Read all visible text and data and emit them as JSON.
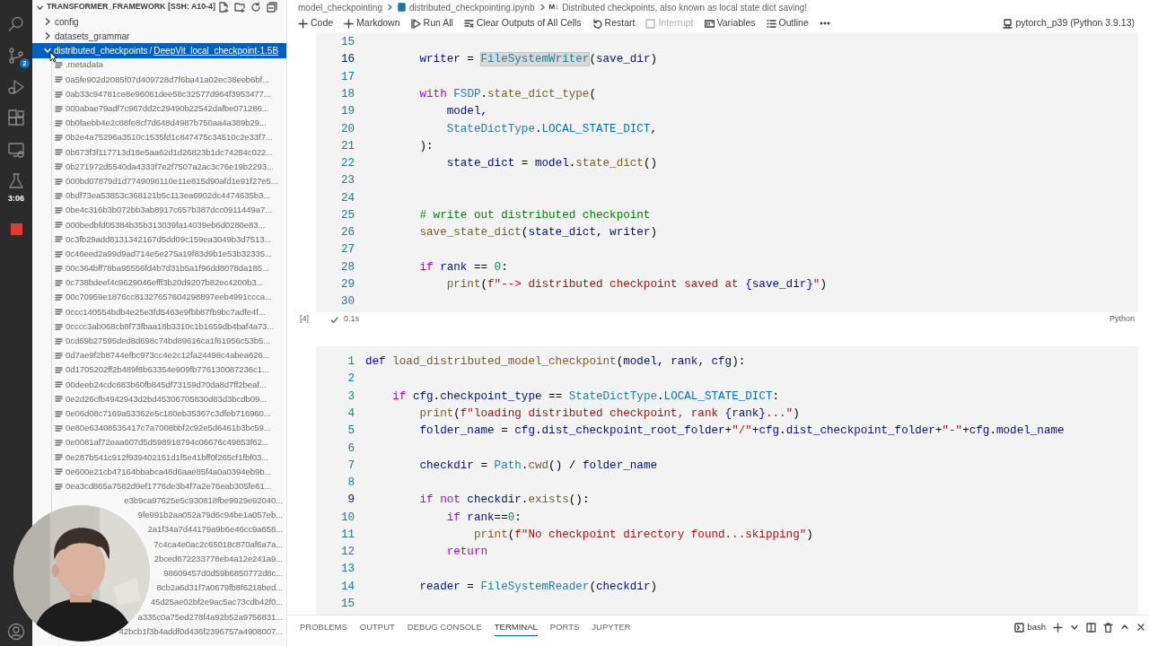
{
  "activity_bar": {
    "items": [
      {
        "kind": "search"
      },
      {
        "kind": "source-control",
        "badge": "2"
      },
      {
        "kind": "run-debug"
      },
      {
        "kind": "extensions"
      },
      {
        "kind": "remote"
      },
      {
        "kind": "testing"
      }
    ],
    "timer": "3:06",
    "recording": true
  },
  "explorer": {
    "title": "TRANSFORMER_FRAMEWORK [SSH: A10-4]",
    "tree": [
      {
        "label": "config",
        "expanded": false,
        "selected": false
      },
      {
        "label": "datasets_grammar",
        "expanded": false,
        "selected": false
      },
      {
        "label": "distributed_checkpoints",
        "separator": "/",
        "sublabel": "DeepVit_local_checkpoint-1.5B",
        "expanded": true,
        "selected": true,
        "children": [
          {
            "label": ".metadata",
            "kind": "file",
            "selected": false
          },
          {
            "label": "0a5fe902d2085f07d409728d7f6ba41a02ec38eeb6bf...",
            "kind": "file",
            "selected": false
          },
          {
            "label": "0ab33c94781ce8e96061dee58c32577d964f3953477...",
            "kind": "file",
            "selected": false
          },
          {
            "label": "000abae79adf7c967dd2c29490b22542dafbe071286...",
            "kind": "file",
            "selected": false
          },
          {
            "label": "0b0faebb4e2c88fe8cf7d648d4987b750aa4a389b29...",
            "kind": "file",
            "selected": false
          },
          {
            "label": "0b2e4a75296a3510c1535fd1c847475c34510c2e33f7...",
            "kind": "file",
            "selected": false
          },
          {
            "label": "0b673f3f117713d18e5aa62d1d26823b1dc74284c022...",
            "kind": "file",
            "selected": false
          },
          {
            "label": "0b271972d5540da4333f7e2f7507a2ac3c76e19b2293...",
            "kind": "file",
            "selected": false
          },
          {
            "label": "000bd07879d1d7749096110e11e815d90afd1e91f27e5...",
            "kind": "file",
            "selected": false
          },
          {
            "label": "0bdf73ea53853c368121b5c113ea6902dc4474635b3...",
            "kind": "file",
            "selected": false
          },
          {
            "label": "0be4c316b3b072bb3ab8917c657b387dcc0911449a7...",
            "kind": "file",
            "selected": false
          },
          {
            "label": "000bedbfd05384b35b313039fa14039eb6d0280e83...",
            "kind": "file",
            "selected": false
          },
          {
            "label": "0c3fb29add8131342167d5dd09c159ea3049b3d7513...",
            "kind": "file",
            "selected": false
          },
          {
            "label": "0c46eed2a99d9ad714e5e275a19f83d9b1e53b32335...",
            "kind": "file",
            "selected": false
          },
          {
            "label": "00c364bff78ba95556fd4b7d31b5a1f96dd8078da185...",
            "kind": "file",
            "selected": false
          },
          {
            "label": "0c738bdeef4c9629046efff3b20d9207b82ec4200b3...",
            "kind": "file",
            "selected": false
          },
          {
            "label": "00c70959e1876cc81327657604298897eeb4991ccca...",
            "kind": "file",
            "selected": false
          },
          {
            "label": "0ccc140554bdb4e25e3fd5463e9fbb87fb9bc7adfe4f...",
            "kind": "file",
            "selected": false
          },
          {
            "label": "0cccc3ab068cb8f73fbaa18b3310c1b1659db4baf4a73...",
            "kind": "file",
            "selected": false
          },
          {
            "label": "0cd69b27595ded8d698c74bd89616ca1f61956c53b5...",
            "kind": "file",
            "selected": false
          },
          {
            "label": "0d7ae9f2b8744efbc973cc4e2c12fa24498c4abea626...",
            "kind": "file",
            "selected": false
          },
          {
            "label": "0d1705202ff2b489f8b63354e909fb776130087236c1...",
            "kind": "file",
            "selected": false
          },
          {
            "label": "00deeb24cdc683b60fb845df73159d70da8d7ff2beaf...",
            "kind": "file",
            "selected": false
          },
          {
            "label": "0e2d26cfb4942943d2bd45306705830d83d3bcdb09...",
            "kind": "file",
            "selected": false
          },
          {
            "label": "0e06d08c7169a53362e5c180eb35367c3dfeb716960...",
            "kind": "file",
            "selected": false
          },
          {
            "label": "0e80e63408535417c7a7008bbf2c92e5d6461b3bc59...",
            "kind": "file",
            "selected": false
          },
          {
            "label": "0e0081af72eaa607d5d598918794c06676c49853f62...",
            "kind": "file",
            "selected": false
          },
          {
            "label": "0e287b541c912f939402151d1f5e41bff0f265cf1fbf03...",
            "kind": "file",
            "selected": false
          },
          {
            "label": "0e600e21cb47164bbabca48d6aae85f4a0a0394eb9b...",
            "kind": "file",
            "selected": false
          },
          {
            "label": "0ea3cd865a7582d9ef1776de3b4f7a2e76eab305fe61...",
            "kind": "file",
            "selected": false
          },
          {
            "label": "e3b9ca97625e5c930818fbe9929e92040...",
            "kind": "covered",
            "selected": false
          },
          {
            "label": "9fe991b2aa052a79d6c94be1a057eb...",
            "kind": "covered",
            "selected": false
          },
          {
            "label": "2a1f34a7d44179a9b6e46cc9a658...",
            "kind": "covered",
            "selected": false
          },
          {
            "label": "7c4ca4e0ac2c65018c870af6a7a...",
            "kind": "covered",
            "selected": false
          },
          {
            "label": "2bced672233778eb4a12e241a9...",
            "kind": "covered",
            "selected": false
          },
          {
            "label": "98609457d0d59b6850772d8c...",
            "kind": "covered",
            "selected": false
          },
          {
            "label": "8cb2a6d31f7a0679fb8f6218bed...",
            "kind": "covered",
            "selected": false
          },
          {
            "label": "45d25ae02bf2e9ac5ac73cdb42f0...",
            "kind": "covered",
            "selected": false
          },
          {
            "label": "a335c0a75ed278f4a92b52a9756831...",
            "kind": "covered",
            "selected": false
          },
          {
            "label": "42bcb1f3b4addf0d436f2396757a4908007...",
            "kind": "covered",
            "selected": false
          }
        ]
      }
    ]
  },
  "breadcrumbs": [
    {
      "label": "model_checkpointing",
      "kind": "folder"
    },
    {
      "label": "distributed_checkpointing.ipynb",
      "kind": "notebook"
    },
    {
      "label": "Distributed checkpoints, also known as local state dict saving!",
      "kind": "markdown",
      "icon": "M↓"
    }
  ],
  "toolbar": [
    {
      "label": "Code",
      "kind": "add",
      "disabled": false
    },
    {
      "label": "Markdown",
      "kind": "add",
      "disabled": false
    },
    {
      "label": "Run All",
      "kind": "run",
      "disabled": false
    },
    {
      "label": "Clear Outputs of All Cells",
      "kind": "clear",
      "disabled": false
    },
    {
      "label": "Restart",
      "kind": "restart",
      "disabled": false
    },
    {
      "label": "Interrupt",
      "kind": "interrupt",
      "disabled": true
    },
    {
      "label": "Variables",
      "kind": "variables",
      "disabled": false
    },
    {
      "label": "Outline",
      "kind": "outline",
      "disabled": false
    },
    {
      "kind": "more",
      "disabled": false
    }
  ],
  "kernel": "pytorch_p39 (Python 3.9.13)",
  "cells": [
    {
      "execution_count": "[4]",
      "succeeded": true,
      "duration": "0.1s",
      "language": "Python",
      "lines": [
        {
          "number": "15",
          "active": false
        },
        {
          "number": "16",
          "active": true,
          "tokens": [
            {
              "text": "        writer",
              "kind": "var"
            },
            {
              "text": " = ",
              "kind": "plain"
            },
            {
              "text": "FileSystemWriter",
              "kind": "match"
            },
            {
              "text": "(",
              "kind": "plain"
            },
            {
              "text": "save_dir",
              "kind": "var"
            },
            {
              "text": ")",
              "kind": "plain"
            }
          ]
        },
        {
          "number": "17",
          "active": false
        },
        {
          "number": "18",
          "active": false,
          "tokens": [
            {
              "text": "        with",
              "kind": "kw"
            },
            {
              "text": " FSDP",
              "kind": "cls"
            },
            {
              "text": ".",
              "kind": "plain"
            },
            {
              "text": "state_dict_type",
              "kind": "fn"
            },
            {
              "text": "(",
              "kind": "plain"
            }
          ]
        },
        {
          "number": "19",
          "active": false,
          "tokens": [
            {
              "text": "            model",
              "kind": "var"
            },
            {
              "text": ",",
              "kind": "plain"
            }
          ]
        },
        {
          "number": "20",
          "active": false,
          "tokens": [
            {
              "text": "            StateDictType",
              "kind": "cls"
            },
            {
              "text": ".",
              "kind": "plain"
            },
            {
              "text": "LOCAL_STATE_DICT",
              "kind": "const"
            },
            {
              "text": ",",
              "kind": "plain"
            }
          ]
        },
        {
          "number": "21",
          "active": false,
          "tokens": [
            {
              "text": "        ):",
              "kind": "plain"
            }
          ]
        },
        {
          "number": "22",
          "active": false,
          "tokens": [
            {
              "text": "            state_dict",
              "kind": "var"
            },
            {
              "text": " = ",
              "kind": "plain"
            },
            {
              "text": "model",
              "kind": "var"
            },
            {
              "text": ".",
              "kind": "plain"
            },
            {
              "text": "state_dict",
              "kind": "fn"
            },
            {
              "text": "()",
              "kind": "plain"
            }
          ]
        },
        {
          "number": "23",
          "active": false
        },
        {
          "number": "24",
          "active": false
        },
        {
          "number": "25",
          "active": false,
          "tokens": [
            {
              "text": "        # write out distributed checkpoint",
              "kind": "com"
            }
          ]
        },
        {
          "number": "26",
          "active": false,
          "tokens": [
            {
              "text": "        save_state_dict",
              "kind": "fn"
            },
            {
              "text": "(",
              "kind": "plain"
            },
            {
              "text": "state_dict",
              "kind": "var"
            },
            {
              "text": ", ",
              "kind": "plain"
            },
            {
              "text": "writer",
              "kind": "var"
            },
            {
              "text": ")",
              "kind": "plain"
            }
          ]
        },
        {
          "number": "27",
          "active": false
        },
        {
          "number": "28",
          "active": false,
          "tokens": [
            {
              "text": "        if",
              "kind": "kw"
            },
            {
              "text": " rank",
              "kind": "var"
            },
            {
              "text": " == ",
              "kind": "plain"
            },
            {
              "text": "0",
              "kind": "num"
            },
            {
              "text": ":",
              "kind": "plain"
            }
          ]
        },
        {
          "number": "29",
          "active": false,
          "tokens": [
            {
              "text": "            print",
              "kind": "fn"
            },
            {
              "text": "(",
              "kind": "plain"
            },
            {
              "text": "f\"--> distributed checkpoint saved at ",
              "kind": "str"
            },
            {
              "text": "{",
              "kind": "brace"
            },
            {
              "text": "save_dir",
              "kind": "var"
            },
            {
              "text": "}",
              "kind": "brace"
            },
            {
              "text": "\"",
              "kind": "str"
            },
            {
              "text": ")",
              "kind": "plain"
            }
          ]
        },
        {
          "number": "30",
          "active": false
        }
      ]
    },
    {
      "lines": [
        {
          "number": "1",
          "active": false,
          "tokens": [
            {
              "text": "def",
              "kind": "storage"
            },
            {
              "text": " load_distributed_model_checkpoint",
              "kind": "fn"
            },
            {
              "text": "(",
              "kind": "plain"
            },
            {
              "text": "model",
              "kind": "var"
            },
            {
              "text": ", ",
              "kind": "plain"
            },
            {
              "text": "rank",
              "kind": "var"
            },
            {
              "text": ", ",
              "kind": "plain"
            },
            {
              "text": "cfg",
              "kind": "var"
            },
            {
              "text": "):",
              "kind": "plain"
            }
          ]
        },
        {
          "number": "2",
          "active": false
        },
        {
          "number": "3",
          "active": false,
          "tokens": [
            {
              "text": "    if",
              "kind": "kw"
            },
            {
              "text": " cfg",
              "kind": "var"
            },
            {
              "text": ".",
              "kind": "plain"
            },
            {
              "text": "checkpoint_type",
              "kind": "var"
            },
            {
              "text": " == ",
              "kind": "plain"
            },
            {
              "text": "StateDictType",
              "kind": "cls"
            },
            {
              "text": ".",
              "kind": "plain"
            },
            {
              "text": "LOCAL_STATE_DICT",
              "kind": "const"
            },
            {
              "text": ":",
              "kind": "plain"
            }
          ]
        },
        {
          "number": "4",
          "active": false,
          "tokens": [
            {
              "text": "        print",
              "kind": "fn"
            },
            {
              "text": "(",
              "kind": "plain"
            },
            {
              "text": "f\"loading distributed checkpoint, rank ",
              "kind": "str"
            },
            {
              "text": "{",
              "kind": "brace"
            },
            {
              "text": "rank",
              "kind": "var"
            },
            {
              "text": "}",
              "kind": "brace"
            },
            {
              "text": "...\"",
              "kind": "str"
            },
            {
              "text": ")",
              "kind": "plain"
            }
          ]
        },
        {
          "number": "5",
          "active": false,
          "tokens": [
            {
              "text": "        folder_name",
              "kind": "var"
            },
            {
              "text": " = ",
              "kind": "plain"
            },
            {
              "text": "cfg",
              "kind": "var"
            },
            {
              "text": ".",
              "kind": "plain"
            },
            {
              "text": "dist_checkpoint_root_folder",
              "kind": "var"
            },
            {
              "text": "+",
              "kind": "plain"
            },
            {
              "text": "\"/\"",
              "kind": "str"
            },
            {
              "text": "+",
              "kind": "plain"
            },
            {
              "text": "cfg",
              "kind": "var"
            },
            {
              "text": ".",
              "kind": "plain"
            },
            {
              "text": "dist_checkpoint_folder",
              "kind": "var"
            },
            {
              "text": "+",
              "kind": "plain"
            },
            {
              "text": "\"-\"",
              "kind": "str"
            },
            {
              "text": "+",
              "kind": "plain"
            },
            {
              "text": "cfg",
              "kind": "var"
            },
            {
              "text": ".",
              "kind": "plain"
            },
            {
              "text": "model_name",
              "kind": "var"
            }
          ]
        },
        {
          "number": "6",
          "active": false
        },
        {
          "number": "7",
          "active": false,
          "tokens": [
            {
              "text": "        checkdir",
              "kind": "var"
            },
            {
              "text": " = ",
              "kind": "plain"
            },
            {
              "text": "Path",
              "kind": "cls"
            },
            {
              "text": ".",
              "kind": "plain"
            },
            {
              "text": "cwd",
              "kind": "fn"
            },
            {
              "text": "() / ",
              "kind": "plain"
            },
            {
              "text": "folder_name",
              "kind": "var"
            }
          ]
        },
        {
          "number": "8",
          "active": false
        },
        {
          "number": "9",
          "active": true,
          "tokens": [
            {
              "text": "        if not",
              "kind": "kw"
            },
            {
              "text": " checkdir",
              "kind": "var"
            },
            {
              "text": ".",
              "kind": "plain"
            },
            {
              "text": "exists",
              "kind": "fn"
            },
            {
              "text": "():",
              "kind": "plain"
            }
          ]
        },
        {
          "number": "10",
          "active": false,
          "tokens": [
            {
              "text": "            if",
              "kind": "kw"
            },
            {
              "text": " rank",
              "kind": "var"
            },
            {
              "text": "==",
              "kind": "plain"
            },
            {
              "text": "0",
              "kind": "num"
            },
            {
              "text": ":",
              "kind": "plain"
            }
          ]
        },
        {
          "number": "11",
          "active": false,
          "tokens": [
            {
              "text": "                print",
              "kind": "fn"
            },
            {
              "text": "(",
              "kind": "plain"
            },
            {
              "text": "f\"No checkpoint directory found...skipping\"",
              "kind": "str"
            },
            {
              "text": ")",
              "kind": "plain"
            }
          ]
        },
        {
          "number": "12",
          "active": false,
          "tokens": [
            {
              "text": "            return",
              "kind": "kw"
            }
          ]
        },
        {
          "number": "13",
          "active": false
        },
        {
          "number": "14",
          "active": false,
          "tokens": [
            {
              "text": "        reader",
              "kind": "var"
            },
            {
              "text": " = ",
              "kind": "plain"
            },
            {
              "text": "FileSystemReader",
              "kind": "cls"
            },
            {
              "text": "(",
              "kind": "plain"
            },
            {
              "text": "checkdir",
              "kind": "var"
            },
            {
              "text": ")",
              "kind": "plain"
            }
          ]
        },
        {
          "number": "15",
          "active": false
        }
      ]
    }
  ],
  "panel": {
    "tabs": [
      {
        "label": "PROBLEMS",
        "selected": false
      },
      {
        "label": "OUTPUT",
        "selected": false
      },
      {
        "label": "DEBUG CONSOLE",
        "selected": false
      },
      {
        "label": "TERMINAL",
        "selected": true
      },
      {
        "label": "PORTS",
        "selected": false
      },
      {
        "label": "JUPYTER",
        "selected": false
      }
    ],
    "terminal": "bash"
  }
}
